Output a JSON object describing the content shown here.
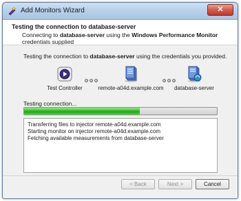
{
  "window": {
    "title": "Add Monitors Wizard",
    "close_glyph": "✕"
  },
  "header": {
    "title": "Testing the connection to database-server",
    "desc_prefix": "Connecting to ",
    "desc_server": "database-server",
    "desc_middle": " using the ",
    "desc_monitor": "Windows Performance Monitor",
    "desc_suffix": " credentials supplied"
  },
  "main": {
    "testing_prefix": "Testing the connection to ",
    "testing_server": "database-server",
    "testing_suffix": " using the credentials you provided.",
    "nodes": {
      "controller": "Test Controller",
      "injector": "remote-a04d.example.com",
      "server": "database-server"
    },
    "status": "Testing connection...",
    "progress": 0.6,
    "log": [
      "Transferring files to injector remote-a04d.example.com",
      "Starting monitor on injector remote-a04d.example.com",
      "Fetching available measurements from database-server"
    ]
  },
  "footer": {
    "back": "< Back",
    "next": "Next >",
    "cancel": "Cancel"
  },
  "colors": {
    "progress": "#2fb52a",
    "titlebar": "#b9d1ea",
    "close": "#c0392b"
  },
  "icons": {
    "app": "wizard-icon",
    "controller": "play-icon",
    "injector": "server-icon",
    "database": "database-server-icon"
  }
}
